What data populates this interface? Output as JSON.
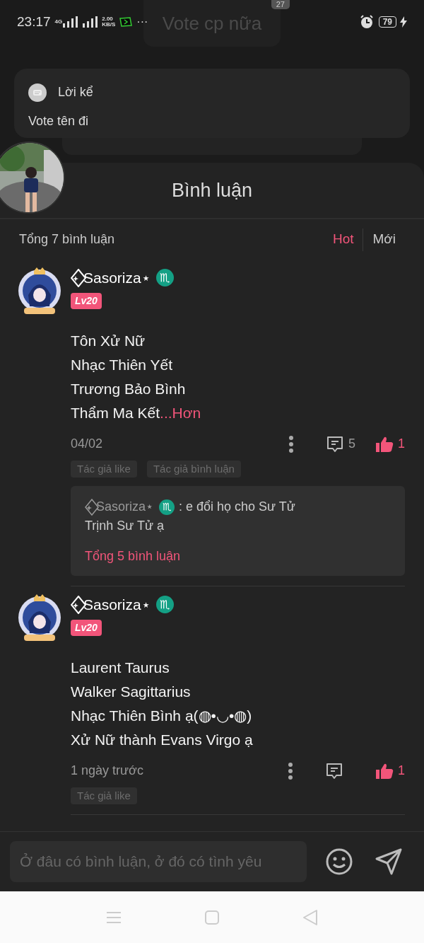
{
  "status_bar": {
    "time": "23:17",
    "network": "4G",
    "speed_value": "2.00",
    "speed_unit": "KB/S",
    "more": "···",
    "battery": "79"
  },
  "background_message": {
    "text": "Vote cp nữa",
    "badge": "27"
  },
  "narration": {
    "title": "Lời kể",
    "text": "Vote tên đi"
  },
  "comments_panel": {
    "title": "Bình luận",
    "total": "Tổng 7 bình luận",
    "sort_tabs": [
      {
        "label": "Hot",
        "selected": true
      },
      {
        "label": "Mới",
        "selected": false
      }
    ],
    "comments": [
      {
        "user": "Sasoriza⋆",
        "zodiac": "♏",
        "level": "Lv20",
        "lines": [
          "Tôn Xử Nữ",
          "Nhạc Thiên Yết",
          "Trương Bảo Bình",
          "Thẩm Ma Kết"
        ],
        "more": "...Hơn",
        "date": "04/02",
        "reply_count": "5",
        "likes": "1",
        "liked": true,
        "tags": [
          "Tác giả like",
          "Tác giả bình luận"
        ],
        "reply_preview": {
          "user": "Sasoriza⋆",
          "zodiac": "♏",
          "text_lines": [
            ": e đổi họ cho Sư Tử",
            "Trịnh Sư Tử ạ"
          ],
          "total": "Tổng 5 bình luận"
        }
      },
      {
        "user": "Sasoriza⋆",
        "zodiac": "♏",
        "level": "Lv20",
        "lines": [
          "Laurent Taurus",
          "Walker Sagittarius",
          "Nhạc Thiên Bình ạ(◍•◡•◍)",
          "Xử Nữ thành Evans Virgo ạ"
        ],
        "date": "1 ngày trước",
        "likes": "1",
        "liked": true,
        "tags": [
          "Tác giả like"
        ]
      }
    ]
  },
  "comment_input": {
    "placeholder": "Ở đâu có bình luận, ở đó có tình yêu"
  }
}
